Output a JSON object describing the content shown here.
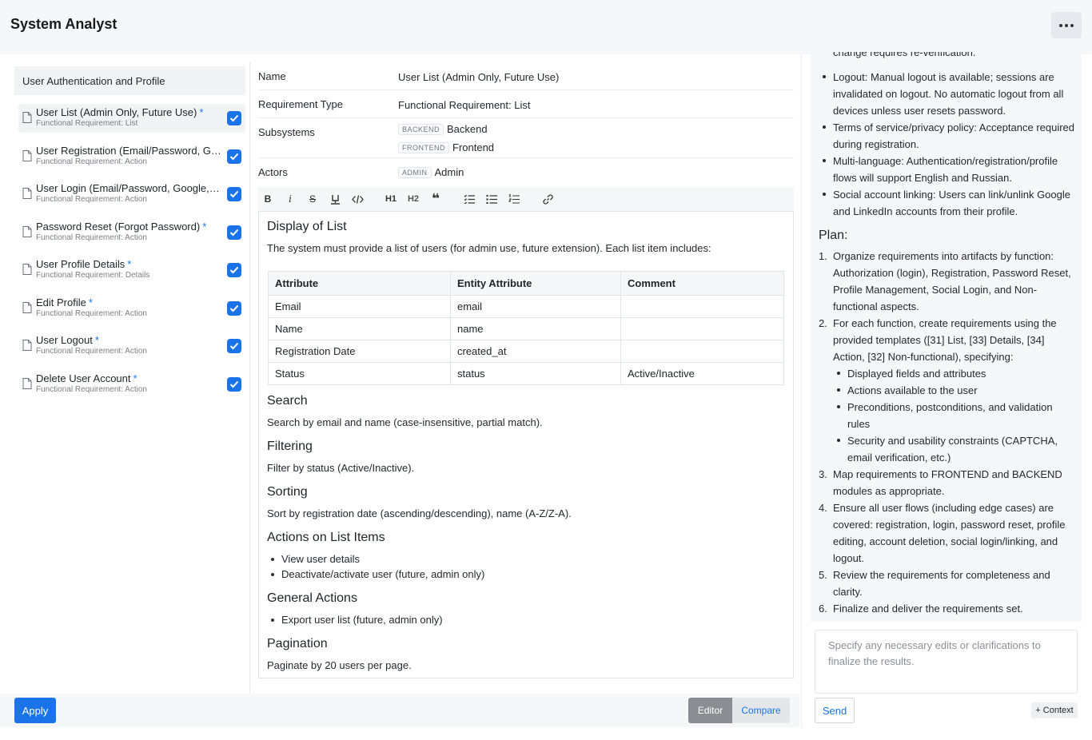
{
  "app": {
    "title": "System Analyst"
  },
  "left": {
    "group": "User Authentication and Profile",
    "items": [
      {
        "title": "User List (Admin Only, Future Use)",
        "type": "Functional Requirement: List"
      },
      {
        "title": "User Registration (Email/Password, Google, LinkedIn)",
        "type": "Functional Requirement: Action"
      },
      {
        "title": "User Login (Email/Password, Google, LinkedIn)",
        "type": "Functional Requirement: Action"
      },
      {
        "title": "Password Reset (Forgot Password)",
        "type": "Functional Requirement: Action"
      },
      {
        "title": "User Profile Details",
        "type": "Functional Requirement: Details"
      },
      {
        "title": "Edit Profile",
        "type": "Functional Requirement: Action"
      },
      {
        "title": "User Logout",
        "type": "Functional Requirement: Action"
      },
      {
        "title": "Delete User Account",
        "type": "Functional Requirement: Action"
      }
    ],
    "star": "*",
    "apply_label": "Apply"
  },
  "fields": {
    "name_label": "Name",
    "name_value": "User List (Admin Only, Future Use)",
    "type_label": "Requirement Type",
    "type_value": "Functional Requirement: List",
    "subsystems_label": "Subsystems",
    "subsystems": [
      {
        "tag": "BACKEND",
        "name": "Backend"
      },
      {
        "tag": "FRONTEND",
        "name": "Frontend"
      }
    ],
    "actors_label": "Actors",
    "actors": [
      {
        "tag": "ADMIN",
        "name": "Admin"
      }
    ]
  },
  "toolbar": {
    "h1": "H1",
    "h2": "H2"
  },
  "editor": {
    "h_display": "Display of List",
    "p_display": "The system must provide a list of users (for admin use, future extension). Each list item includes:",
    "table": {
      "headers": [
        "Attribute",
        "Entity Attribute",
        "Comment"
      ],
      "rows": [
        [
          "Email",
          "email",
          ""
        ],
        [
          "Name",
          "name",
          ""
        ],
        [
          "Registration Date",
          "created_at",
          ""
        ],
        [
          "Status",
          "status",
          "Active/Inactive"
        ]
      ]
    },
    "h_search": "Search",
    "p_search": "Search by email and name (case-insensitive, partial match).",
    "h_filter": "Filtering",
    "p_filter": "Filter by status (Active/Inactive).",
    "h_sort": "Sorting",
    "p_sort": "Sort by registration date (ascending/descending), name (A-Z/Z-A).",
    "h_actions": "Actions on List Items",
    "actions": [
      "View user details",
      "Deactivate/activate user (future, admin only)"
    ],
    "h_general": "General Actions",
    "general": [
      "Export user list (future, admin only)"
    ],
    "h_pagination": "Pagination",
    "p_pagination": "Paginate by 20 users per page."
  },
  "mode": {
    "editor": "Editor",
    "compare": "Compare"
  },
  "chat": {
    "clipped_line": "change requires re-verification.",
    "bullets": [
      "Logout: Manual logout is available; sessions are invalidated on logout. No automatic logout from all devices unless user resets password.",
      "Terms of service/privacy policy: Acceptance required during registration.",
      "Multi-language: Authentication/registration/profile flows will support English and Russian.",
      "Social account linking: Users can link/unlink Google and LinkedIn accounts from their profile."
    ],
    "plan_title": "Plan:",
    "plan": [
      "Organize requirements into artifacts by function: Authorization (login), Registration, Password Reset, Profile Management, Social Login, and Non-functional aspects.",
      "For each function, create requirements using the provided templates ([31] List, [33] Details, [34] Action, [32] Non-functional), specifying:",
      "Map requirements to FRONTEND and BACKEND modules as appropriate.",
      "Ensure all user flows (including edge cases) are covered: registration, login, password reset, profile editing, account deletion, social login/linking, and logout.",
      "Review the requirements for completeness and clarity.",
      "Finalize and deliver the requirements set."
    ],
    "plan_sub": [
      "Displayed fields and attributes",
      "Actions available to the user",
      "Preconditions, postconditions, and validation rules",
      "Security and usability constraints (CAPTCHA, email verification, etc.)"
    ],
    "numbers": [
      "1.",
      "2.",
      "3.",
      "4.",
      "5.",
      "6."
    ],
    "placeholder": "Specify any necessary edits or clarifications to finalize the results.",
    "send_label": "Send",
    "context_label": "+ Context"
  }
}
